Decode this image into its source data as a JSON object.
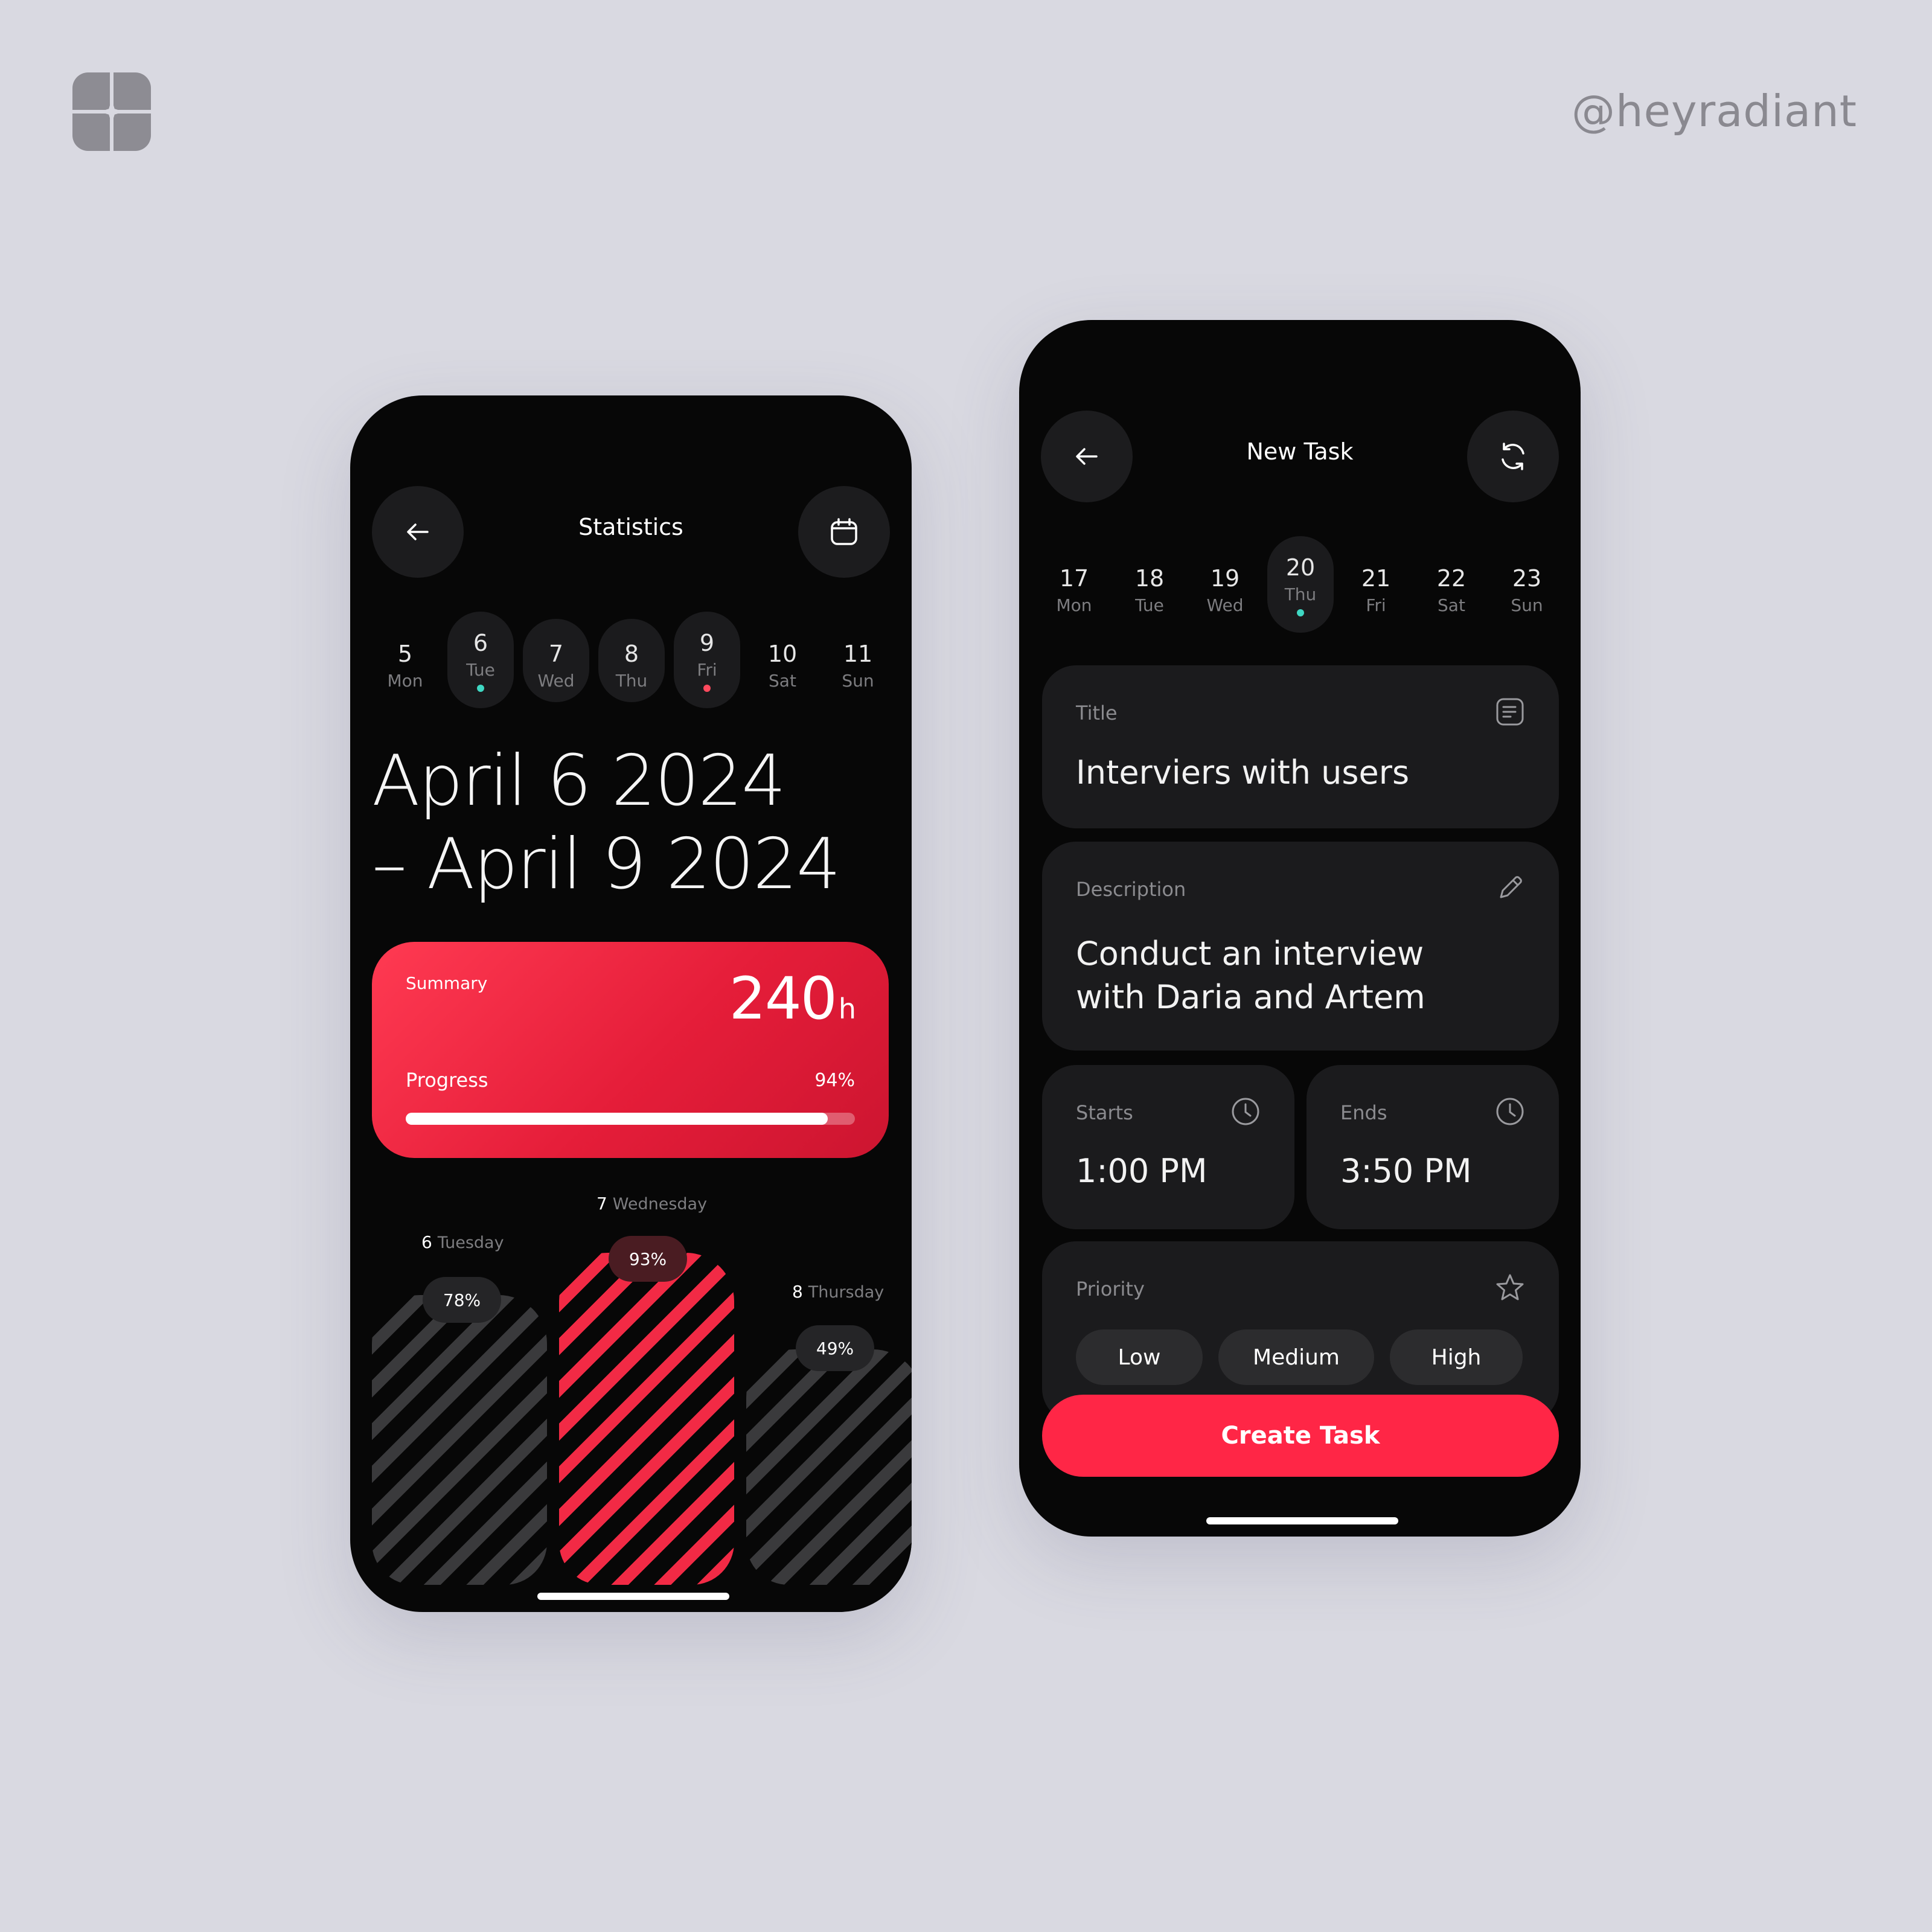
{
  "brand": {
    "handle": "@heyradiant",
    "logo_icon": "sparkle-logo-icon"
  },
  "colors": {
    "accent": "#ff2646",
    "background": "#d9d9e1",
    "phone": "#070707",
    "card": "#1b1b1d",
    "teal_dot": "#3fd8c3",
    "red_dot": "#ff4a5e"
  },
  "statistics": {
    "title": "Statistics",
    "back_icon": "arrow-left-icon",
    "calendar_icon": "calendar-icon",
    "days": [
      {
        "num": "5",
        "dow": "Mon"
      },
      {
        "num": "6",
        "dow": "Tue",
        "selected": true,
        "dot": "teal"
      },
      {
        "num": "7",
        "dow": "Wed",
        "selected": true
      },
      {
        "num": "8",
        "dow": "Thu",
        "selected": true
      },
      {
        "num": "9",
        "dow": "Fri",
        "selected": true,
        "dot": "red"
      },
      {
        "num": "10",
        "dow": "Sat"
      },
      {
        "num": "11",
        "dow": "Sun"
      }
    ],
    "range_line1": "April 6 2024",
    "range_line2": "– April 9 2024",
    "summary": {
      "label": "Summary",
      "hours": "240",
      "unit": "h",
      "progress_label": "Progress",
      "progress_text": "94%",
      "progress": 0.94
    },
    "bars": [
      {
        "num": "6",
        "day": "Tuesday",
        "percent_text": "78%",
        "value": 78,
        "style": "grey"
      },
      {
        "num": "7",
        "day": "Wednesday",
        "percent_text": "93%",
        "value": 93,
        "style": "red"
      },
      {
        "num": "8",
        "day": "Thursday",
        "percent_text": "49%",
        "value": 49,
        "style": "grey"
      }
    ]
  },
  "new_task": {
    "title": "New Task",
    "back_icon": "arrow-left-icon",
    "refresh_icon": "refresh-icon",
    "days": [
      {
        "num": "17",
        "dow": "Mon"
      },
      {
        "num": "18",
        "dow": "Tue"
      },
      {
        "num": "19",
        "dow": "Wed"
      },
      {
        "num": "20",
        "dow": "Thu",
        "selected": true,
        "dot": "teal"
      },
      {
        "num": "21",
        "dow": "Fri"
      },
      {
        "num": "22",
        "dow": "Sat"
      },
      {
        "num": "23",
        "dow": "Sun"
      }
    ],
    "title_field": {
      "label": "Title",
      "value": "Interviers with users",
      "icon": "note-icon"
    },
    "description_field": {
      "label": "Description",
      "line1": "Conduct an interview",
      "line2": "with Daria and Artem",
      "icon": "pencil-icon"
    },
    "starts": {
      "label": "Starts",
      "value": "1:00 PM",
      "icon": "clock-icon"
    },
    "ends": {
      "label": "Ends",
      "value": "3:50 PM",
      "icon": "clock-icon"
    },
    "priority": {
      "label": "Priority",
      "icon": "star-icon",
      "options": [
        "Low",
        "Medium",
        "High"
      ]
    },
    "cta": "Create Task"
  }
}
